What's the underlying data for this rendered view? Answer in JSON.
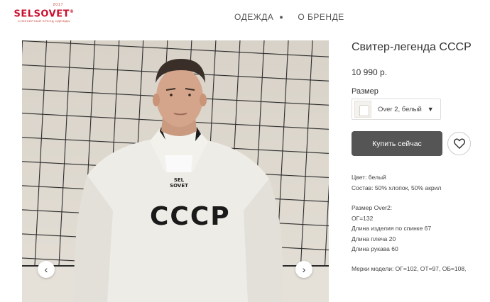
{
  "header": {
    "logo": {
      "year": "2017",
      "name": "SELSOVET",
      "reg": "®",
      "tagline": "СУВЕНИРНЫЙ БРЕНД ОДЕЖДЫ"
    },
    "nav": [
      {
        "label": "ОДЕЖДА",
        "dropdown": true
      },
      {
        "label": "О БРЕНДЕ"
      }
    ]
  },
  "gallery": {
    "shirt_text": "СССР",
    "label_text": "SEL SOVET",
    "prev_icon": "‹",
    "next_icon": "›"
  },
  "product": {
    "title": "Свитер-легенда СССР",
    "price": "10 990 р.",
    "size_label": "Размер",
    "size_selected": "Over 2, белый",
    "buy_label": "Купить сейчас",
    "color_line": "Цвет: белый",
    "composition_line": "Состав: 50% хлопок, 50% акрил",
    "size_heading": "Размер Over2:",
    "measurements": [
      "ОГ=132",
      "Длина изделия по спинке 67",
      "Длина плеча 20",
      "Длина рукава 60"
    ],
    "model_line": "Мерки модели: ОГ=102, ОТ=97, ОБ=108,"
  },
  "colors": {
    "brand_red": "#c8102e",
    "button_bg": "#555555",
    "sweater": "#eeece6",
    "net": "#2a2a2a",
    "wall": "#dcd6cc"
  }
}
